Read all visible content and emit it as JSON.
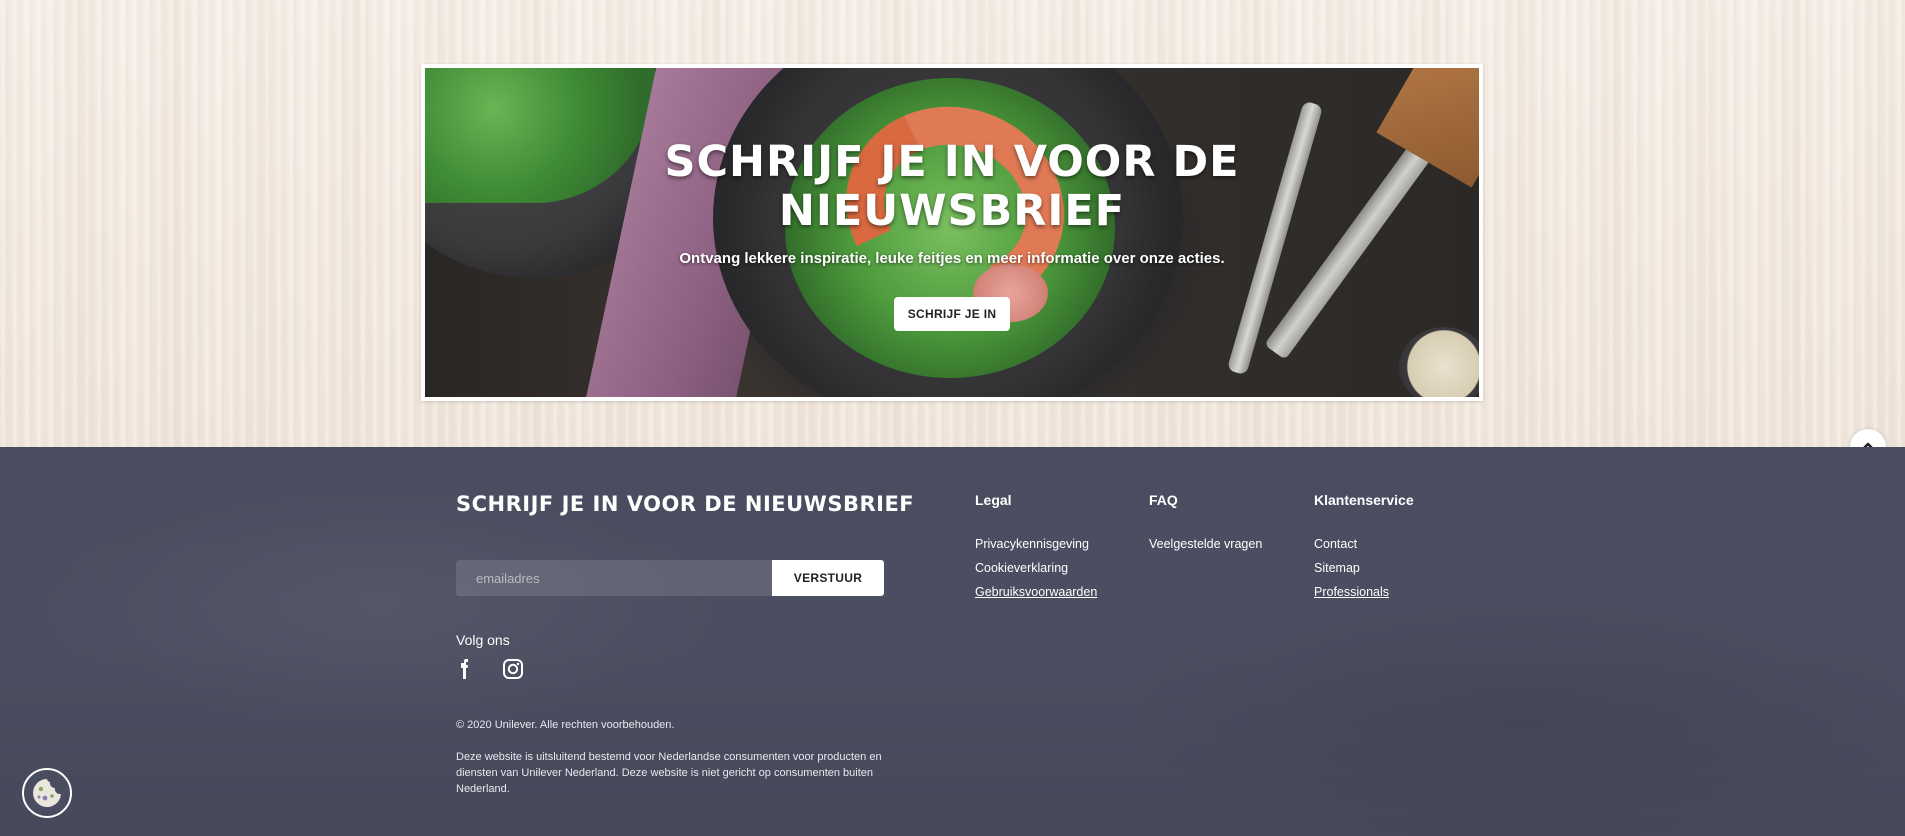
{
  "banner": {
    "title": "SCHRIJF JE IN VOOR DE NIEUWSBRIEF",
    "subtitle": "Ontvang lekkere inspiratie, leuke feitjes en meer informatie over onze acties.",
    "button_label": "SCHRIJF JE IN"
  },
  "footer": {
    "newsletter_title": "SCHRIJF JE IN VOOR DE NIEUWSBRIEF",
    "email_placeholder": "emailadres",
    "submit_label": "VERSTUUR",
    "follow_label": "Volg ons",
    "social": [
      {
        "name": "facebook",
        "icon": "facebook-icon"
      },
      {
        "name": "instagram",
        "icon": "instagram-icon"
      }
    ],
    "copyright": "© 2020 Unilever. Alle rechten voorbehouden.",
    "disclaimer": "Deze website is uitsluitend bestemd voor Nederlandse consumenten voor producten en diensten van Unilever Nederland. Deze website is niet gericht op consumenten buiten Nederland.",
    "columns": {
      "legal": {
        "heading": "Legal",
        "links": [
          "Privacykennisgeving",
          "Cookieverklaring",
          "Gebruiksvoorwaarden"
        ]
      },
      "faq": {
        "heading": "FAQ",
        "links": [
          "Veelgestelde vragen"
        ]
      },
      "klantenservice": {
        "heading": "Klantenservice",
        "links": [
          "Contact",
          "Sitemap",
          "Professionals"
        ]
      }
    }
  },
  "colors": {
    "footer_bg": "#4a4d5f",
    "wood_bg": "#f3ebe3",
    "text_light": "#ffffff"
  },
  "icons": {
    "back_to_top": "chevron-up-icon",
    "cookie": "cookie-icon"
  }
}
